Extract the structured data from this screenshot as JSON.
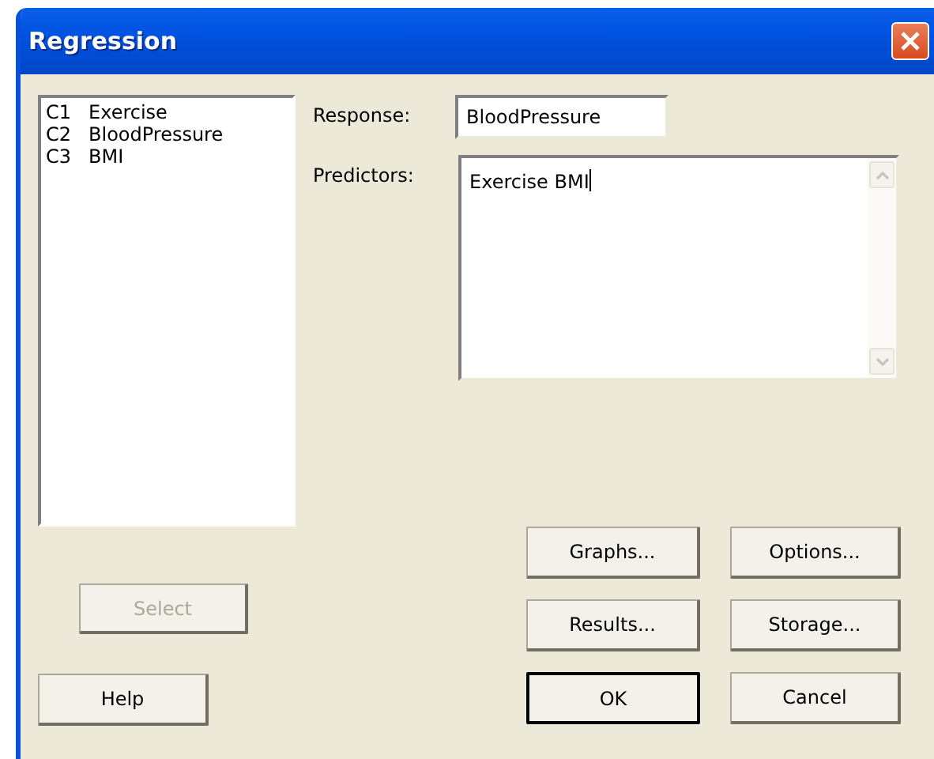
{
  "window": {
    "title": "Regression"
  },
  "variables": [
    {
      "column": "C1",
      "name": "Exercise"
    },
    {
      "column": "C2",
      "name": "BloodPressure"
    },
    {
      "column": "C3",
      "name": "BMI"
    }
  ],
  "response": {
    "label": "Response:",
    "value": "BloodPressure"
  },
  "predictors": {
    "label": "Predictors:",
    "value": "Exercise BMI",
    "focused": true
  },
  "select_button": {
    "label": "Select",
    "disabled": true
  },
  "help_button": {
    "label": "Help",
    "disabled": false
  },
  "buttons": [
    {
      "label": "Graphs...",
      "default": false
    },
    {
      "label": "Options...",
      "default": false
    },
    {
      "label": "Results...",
      "default": false
    },
    {
      "label": "Storage...",
      "default": false
    },
    {
      "label": "OK",
      "default": true
    },
    {
      "label": "Cancel",
      "default": false
    }
  ]
}
